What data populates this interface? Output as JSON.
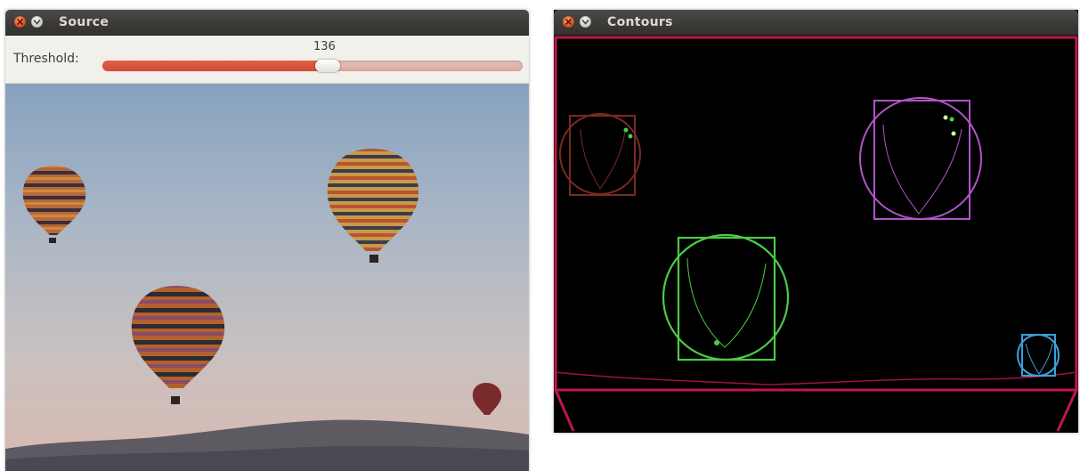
{
  "source_window": {
    "title": "Source",
    "threshold_label": "Threshold:",
    "threshold_value": "136",
    "threshold_fraction": 0.535,
    "image_subject": "hot-air-balloons-photo"
  },
  "contours_window": {
    "title": "Contours",
    "image_subject": "contour-detection-output"
  },
  "colors": {
    "slider_accent": "#e06048",
    "frame_crimson": "#c01848",
    "contour_brown": "#7a2a22",
    "contour_purple": "#b054c8",
    "contour_green": "#4ccc44",
    "contour_blue": "#3aa0dc"
  },
  "icons": {
    "close": "close-icon",
    "menu": "chevron-down-icon"
  }
}
